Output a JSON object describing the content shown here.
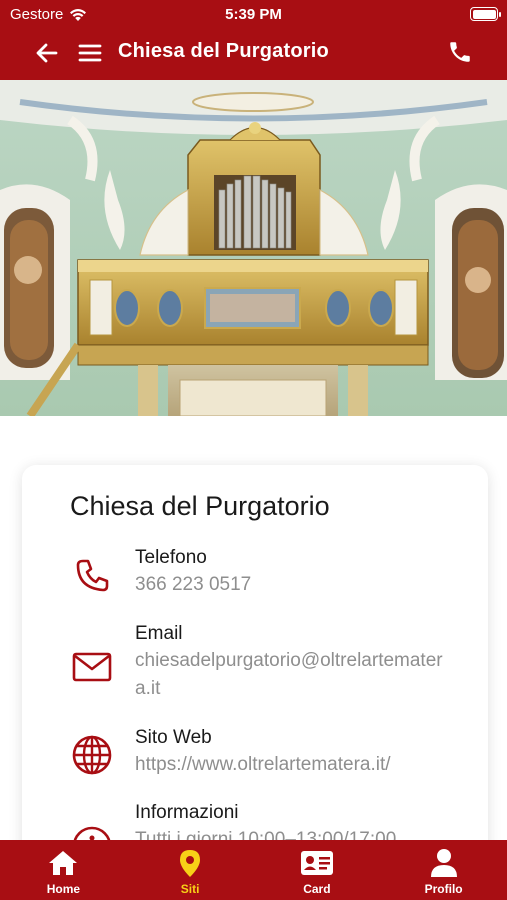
{
  "status": {
    "carrier": "Gestore",
    "time": "5:39 PM"
  },
  "header": {
    "title": "Chiesa del Purgatorio"
  },
  "card": {
    "title": "Chiesa del Purgatorio",
    "phone": {
      "label": "Telefono",
      "value": "366 223 0517"
    },
    "email": {
      "label": "Email",
      "value": "chiesadelpurgatorio@oltrelartematera.it"
    },
    "web": {
      "label": "Sito Web",
      "value": "https://www.oltrelartematera.it/"
    },
    "info": {
      "label": "Informazioni",
      "value": "Tutti i giorni 10:00–13:00/17:00"
    }
  },
  "tabs": [
    {
      "label": "Home",
      "icon": "home-icon"
    },
    {
      "label": "Siti",
      "icon": "map-pin-icon"
    },
    {
      "label": "Card",
      "icon": "id-card-icon"
    },
    {
      "label": "Profilo",
      "icon": "user-icon"
    }
  ],
  "colors": {
    "brand": "#a80e13",
    "active_tab": "#f7d117",
    "muted_text": "#8e8e8e"
  }
}
